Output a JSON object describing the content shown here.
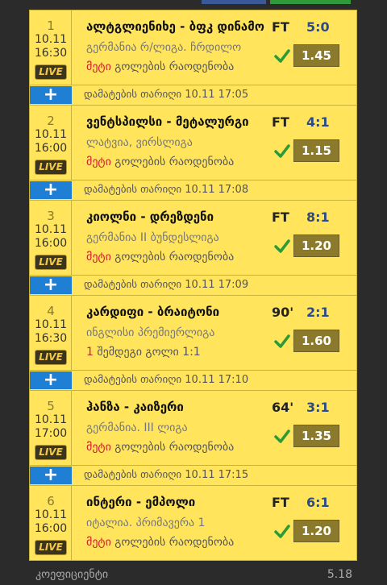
{
  "colors": {
    "card": "#ffe45c",
    "odds": "#8c7a2c",
    "plus": "#1e7fd4",
    "live": "#3a3520",
    "score": "#2a4b88",
    "check": "#2f9a35",
    "market_highlight": "#d01f2a"
  },
  "matches": [
    {
      "num": "1",
      "date": "10.11",
      "time": "16:30",
      "live": "LIVE",
      "teams": "ალტგლიენიხე - ბფკ დინამო",
      "league": "გერმანია რ/ლიგა. ჩრდილო",
      "market_hl": "მეტი",
      "market_rest": " გოლების რაოდენობა",
      "status": "FT",
      "score": "5:0",
      "odds": "1.45"
    },
    {
      "num": "2",
      "date": "10.11",
      "time": "16:00",
      "live": "LIVE",
      "teams": "ვენტსპილსი - მეტალურგი",
      "league": "ლატვია, ვირსლიგა",
      "market_hl": "მეტი",
      "market_rest": " გოლების რაოდენობა",
      "status": "FT",
      "score": "4:1",
      "odds": "1.15"
    },
    {
      "num": "3",
      "date": "10.11",
      "time": "16:00",
      "live": "LIVE",
      "teams": "კიოლნი - დრეზდენი",
      "league": "გერმანია II ბუნდესლიგა",
      "market_hl": "მეტი",
      "market_rest": " გოლების რაოდენობა",
      "status": "FT",
      "score": "8:1",
      "odds": "1.20"
    },
    {
      "num": "4",
      "date": "10.11",
      "time": "16:30",
      "live": "LIVE",
      "teams": "კარდიფი - ბრაიტონი",
      "league": "ინგლისი პრემიერლიგა",
      "market_hl": "1",
      "market_rest": " შემდეგი გოლი 1:1",
      "status": "90'",
      "score": "2:1",
      "odds": "1.60"
    },
    {
      "num": "5",
      "date": "10.11",
      "time": "17:00",
      "live": "LIVE",
      "teams": "ჰანზა - კაიზერი",
      "league": "გერმანია. III ლიგა",
      "market_hl": "მეტი",
      "market_rest": " გოლების რაოდენობა",
      "status": "64'",
      "score": "3:1",
      "odds": "1.35"
    },
    {
      "num": "6",
      "date": "10.11",
      "time": "16:00",
      "live": "LIVE",
      "teams": "ინტერი - ემპოლი",
      "league": "იტალია. პრიმავერა 1",
      "market_hl": "მეტი",
      "market_rest": " გოლების რაოდენობა",
      "status": "FT",
      "score": "6:1",
      "odds": "1.20"
    }
  ],
  "separators": [
    {
      "plus": "+",
      "text": "დამატების თარიღი 10.11 17:05"
    },
    {
      "plus": "+",
      "text": "დამატების თარიღი 10.11 17:08"
    },
    {
      "plus": "+",
      "text": "დამატების თარიღი 10.11 17:09"
    },
    {
      "plus": "+",
      "text": "დამატების თარიღი 10.11 17:10"
    },
    {
      "plus": "+",
      "text": "დამატების თარიღი 10.11 17:15"
    }
  ],
  "footer": {
    "label": "კოეფიციენტი",
    "value": "5.18"
  },
  "icons": {
    "check": "check-icon",
    "add": "plus-icon"
  }
}
